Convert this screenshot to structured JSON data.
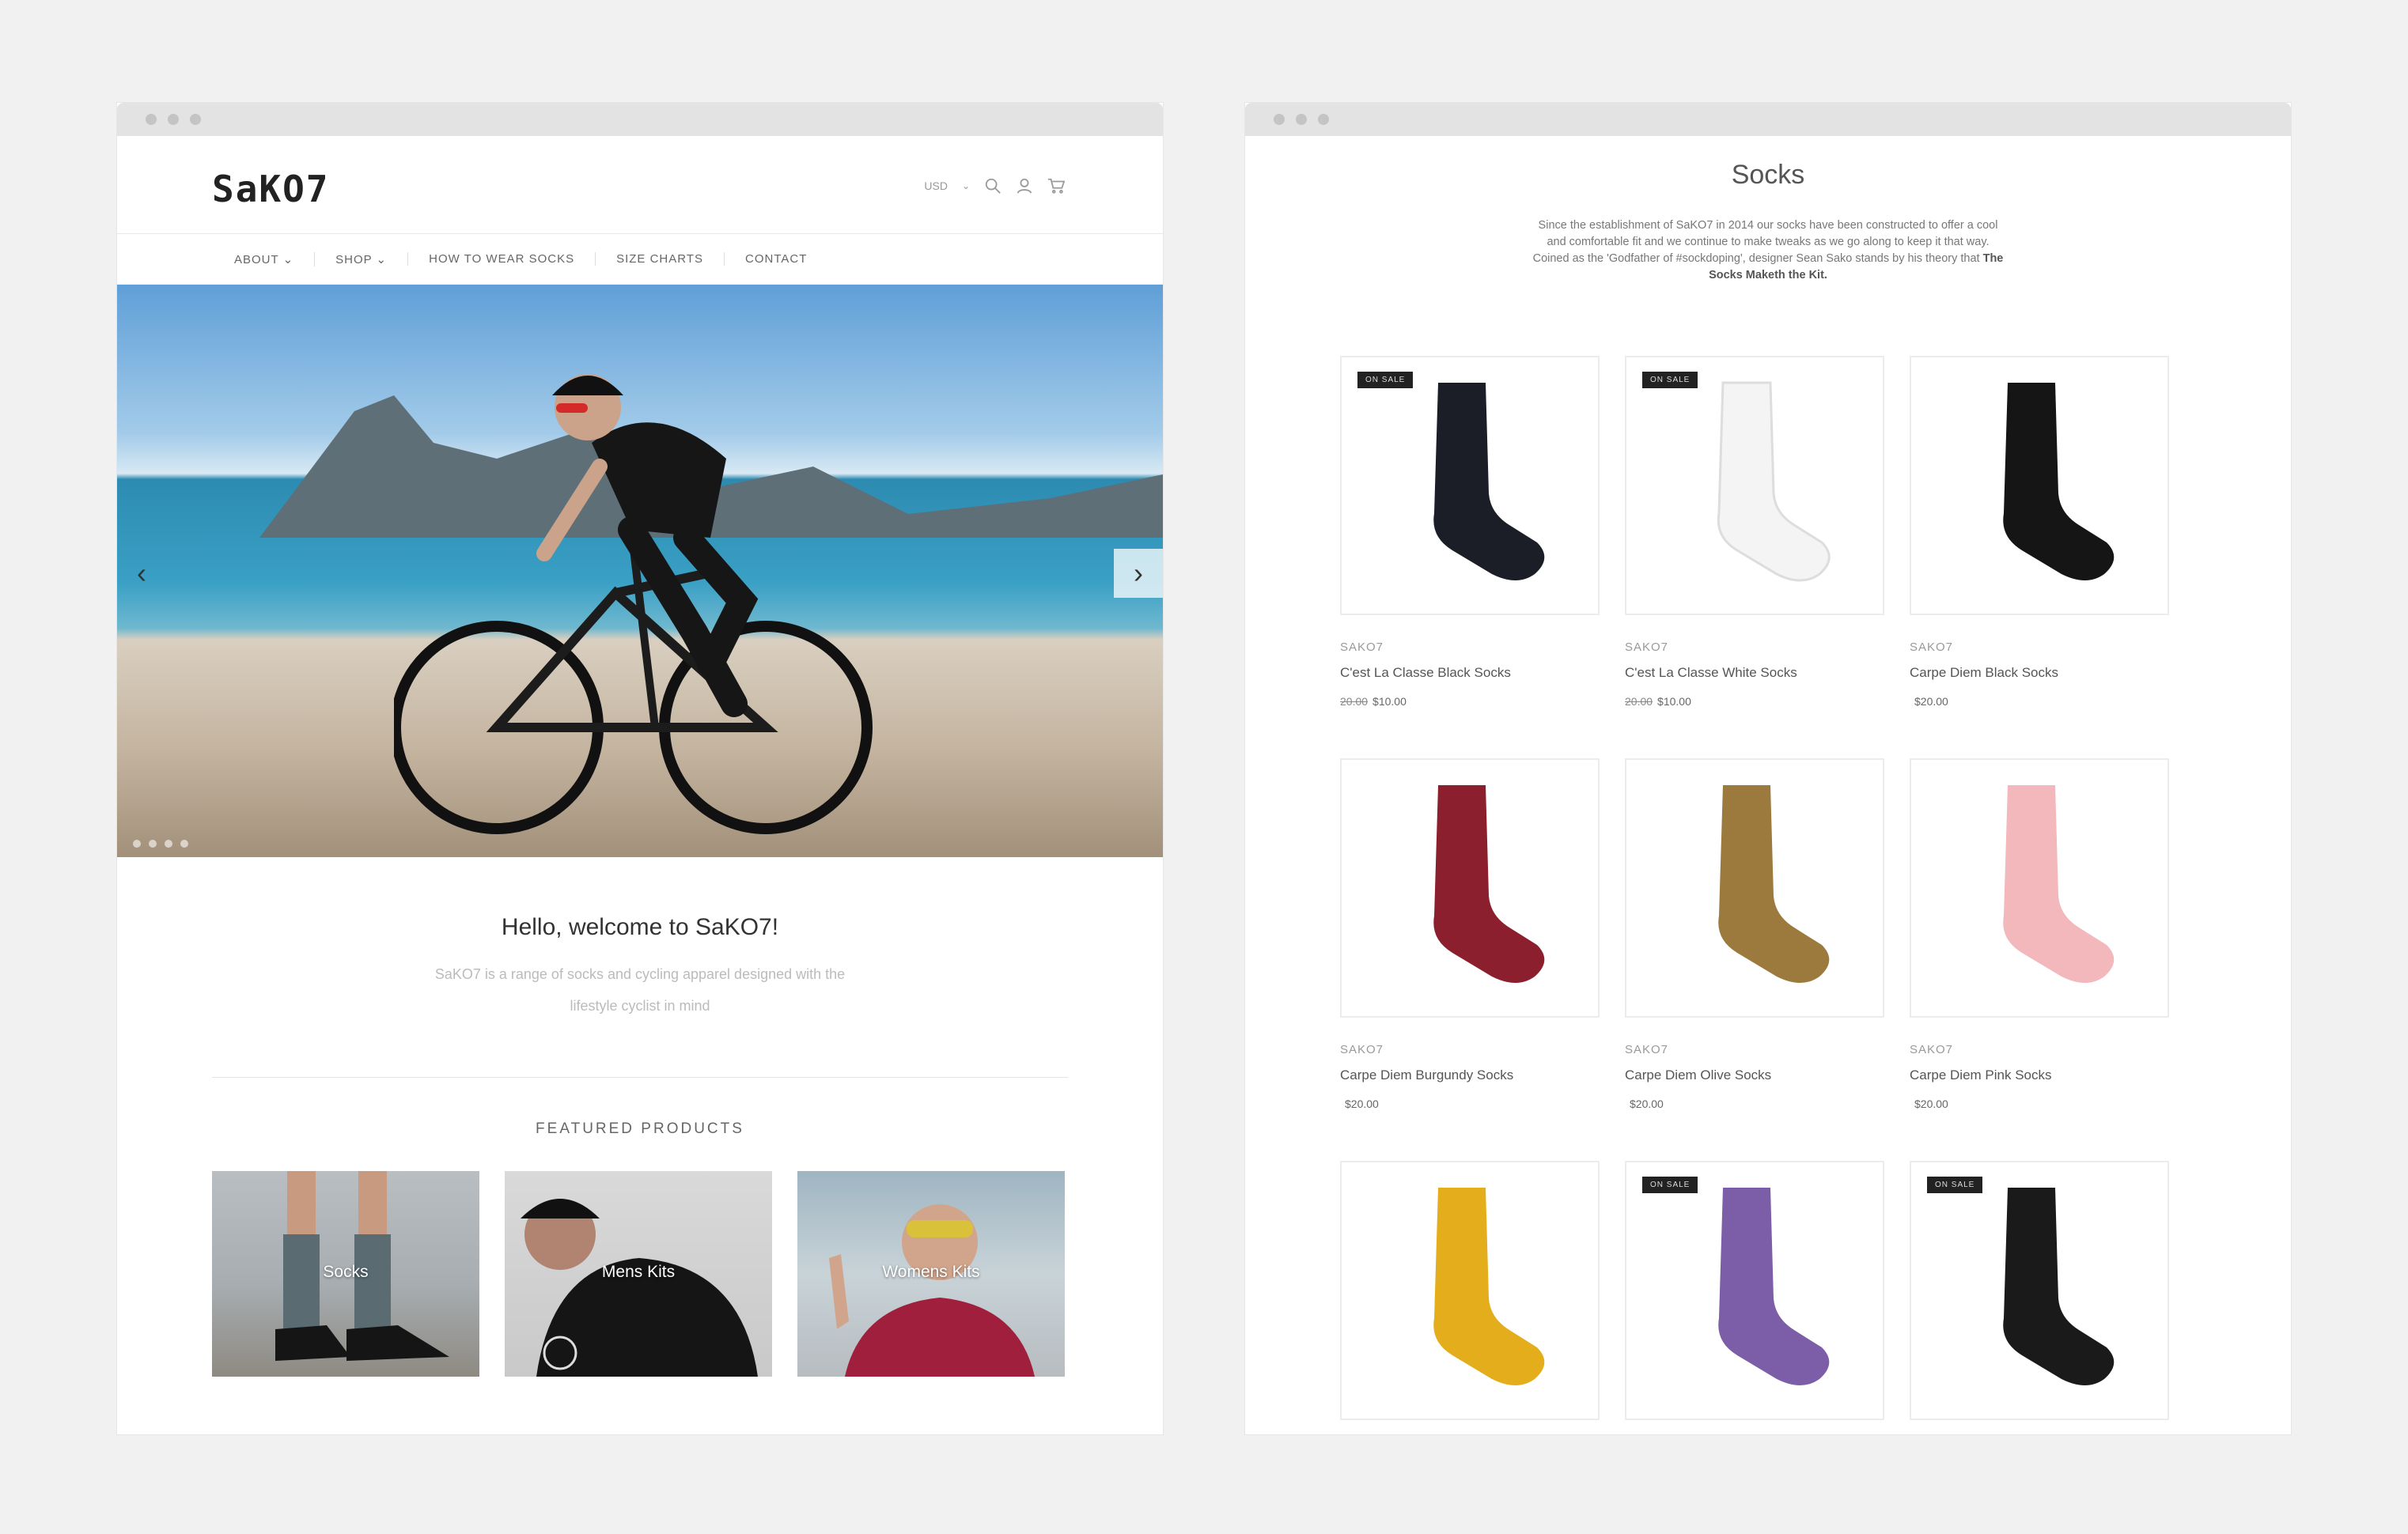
{
  "store": {
    "logo": "SaKO7",
    "currency": "USD",
    "nav": [
      "ABOUT ⌄",
      "SHOP ⌄",
      "HOW TO WEAR SOCKS",
      "SIZE CHARTS",
      "CONTACT"
    ],
    "hero": {
      "prev": "‹",
      "next": "›"
    },
    "welcome_title": "Hello, welcome to SaKO7!",
    "welcome_text": "SaKO7 is a range of socks and cycling apparel designed with the lifestyle cyclist in mind",
    "featured_title": "FEATURED PRODUCTS",
    "featured": [
      {
        "label": "Socks"
      },
      {
        "label": "Mens Kits"
      },
      {
        "label": "Womens Kits"
      }
    ]
  },
  "catalog": {
    "title": "Socks",
    "description": "Since the establishment of SaKO7 in 2014 our socks have been constructed to offer a cool and comfortable fit and we continue to make tweaks as we go along to keep it that way. Coined as the 'Godfather of #sockdoping', designer Sean Sako stands by his theory that",
    "description_bold": "The Socks Maketh the Kit.",
    "badge_label": "ON SALE",
    "products": [
      {
        "vendor": "SAKO7",
        "name": "C'est La Classe Black Socks",
        "was": "20.00",
        "price": "$10.00",
        "on_sale": true,
        "color": "#1b1d27"
      },
      {
        "vendor": "SAKO7",
        "name": "C'est La Classe White Socks",
        "was": "20.00",
        "price": "$10.00",
        "on_sale": true,
        "color": "#f4f4f4"
      },
      {
        "vendor": "SAKO7",
        "name": "Carpe Diem Black Socks",
        "was": "",
        "price": "$20.00",
        "on_sale": false,
        "color": "#151515"
      },
      {
        "vendor": "SAKO7",
        "name": "Carpe Diem Burgundy Socks",
        "was": "",
        "price": "$20.00",
        "on_sale": false,
        "color": "#8c1f2e"
      },
      {
        "vendor": "SAKO7",
        "name": "Carpe Diem Olive Socks",
        "was": "",
        "price": "$20.00",
        "on_sale": false,
        "color": "#9c7a3e"
      },
      {
        "vendor": "SAKO7",
        "name": "Carpe Diem Pink Socks",
        "was": "",
        "price": "$20.00",
        "on_sale": false,
        "color": "#f2b8bb"
      },
      {
        "vendor": "",
        "name": "",
        "was": "",
        "price": "",
        "on_sale": false,
        "color": "#e3ad1c"
      },
      {
        "vendor": "",
        "name": "",
        "was": "",
        "price": "",
        "on_sale": true,
        "color": "#7b5ea7"
      },
      {
        "vendor": "",
        "name": "",
        "was": "",
        "price": "",
        "on_sale": true,
        "color": "#1a1a1a"
      }
    ]
  }
}
